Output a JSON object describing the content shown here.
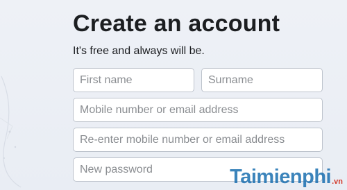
{
  "signup": {
    "title": "Create an account",
    "subtitle": "It's free and always will be.",
    "fields": {
      "first_name_placeholder": "First name",
      "surname_placeholder": "Surname",
      "contact_placeholder": "Mobile number or email address",
      "contact_confirm_placeholder": "Re-enter mobile number or email address",
      "password_placeholder": "New password"
    }
  },
  "watermark": {
    "brand": "Taimienphi",
    "suffix": ".vn"
  },
  "colors": {
    "background": "#edf0f5",
    "title": "#1c1e21",
    "field_border": "#bdc3cc",
    "placeholder": "#8a8d91",
    "watermark_blue": "#1a6fb0",
    "watermark_red": "#d23b2c"
  }
}
